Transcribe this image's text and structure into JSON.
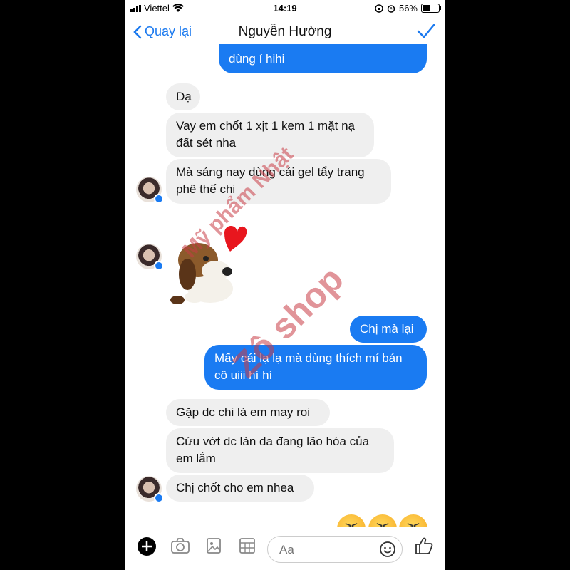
{
  "status": {
    "carrier": "Viettel",
    "time": "14:19",
    "battery": "56%",
    "battery_level": 0.56
  },
  "nav": {
    "back_label": "Quay lại",
    "title": "Nguyễn Hường"
  },
  "messages": [
    {
      "side": "out",
      "text": "dùng í hihi"
    },
    {
      "side": "in",
      "text": "Dạ"
    },
    {
      "side": "in",
      "text": "Vay em chốt 1 xịt 1 kem 1 mặt nạ đất sét nha"
    },
    {
      "side": "in",
      "text": "Mà sáng nay dùng cái gel tẩy trang phê thế chi"
    },
    {
      "side": "in",
      "sticker": "dog-heart-sticker"
    },
    {
      "side": "out",
      "text": "Chị mà lại"
    },
    {
      "side": "out",
      "text": "Mấy cái lạ lạ mà dùng thích mí bán cô uiii hí hí"
    },
    {
      "side": "in",
      "text": "Gặp dc chi là em may roi"
    },
    {
      "side": "in",
      "text": "Cứu vớt dc làn da đang lão hóa của em lắm"
    },
    {
      "side": "in",
      "text": "Chị chốt cho em nhea"
    }
  ],
  "watermark": {
    "line1": "Mỹ phẩm Nhật",
    "line2": "Zô shop"
  },
  "composer": {
    "placeholder": "Aa"
  },
  "icons": [
    "add-icon",
    "camera-icon",
    "photo-icon",
    "gif-icon",
    "emoji-icon",
    "like-icon"
  ],
  "colors": {
    "accent": "#1a7bf2",
    "incoming": "#efefef",
    "watermark": "#c83c46"
  }
}
